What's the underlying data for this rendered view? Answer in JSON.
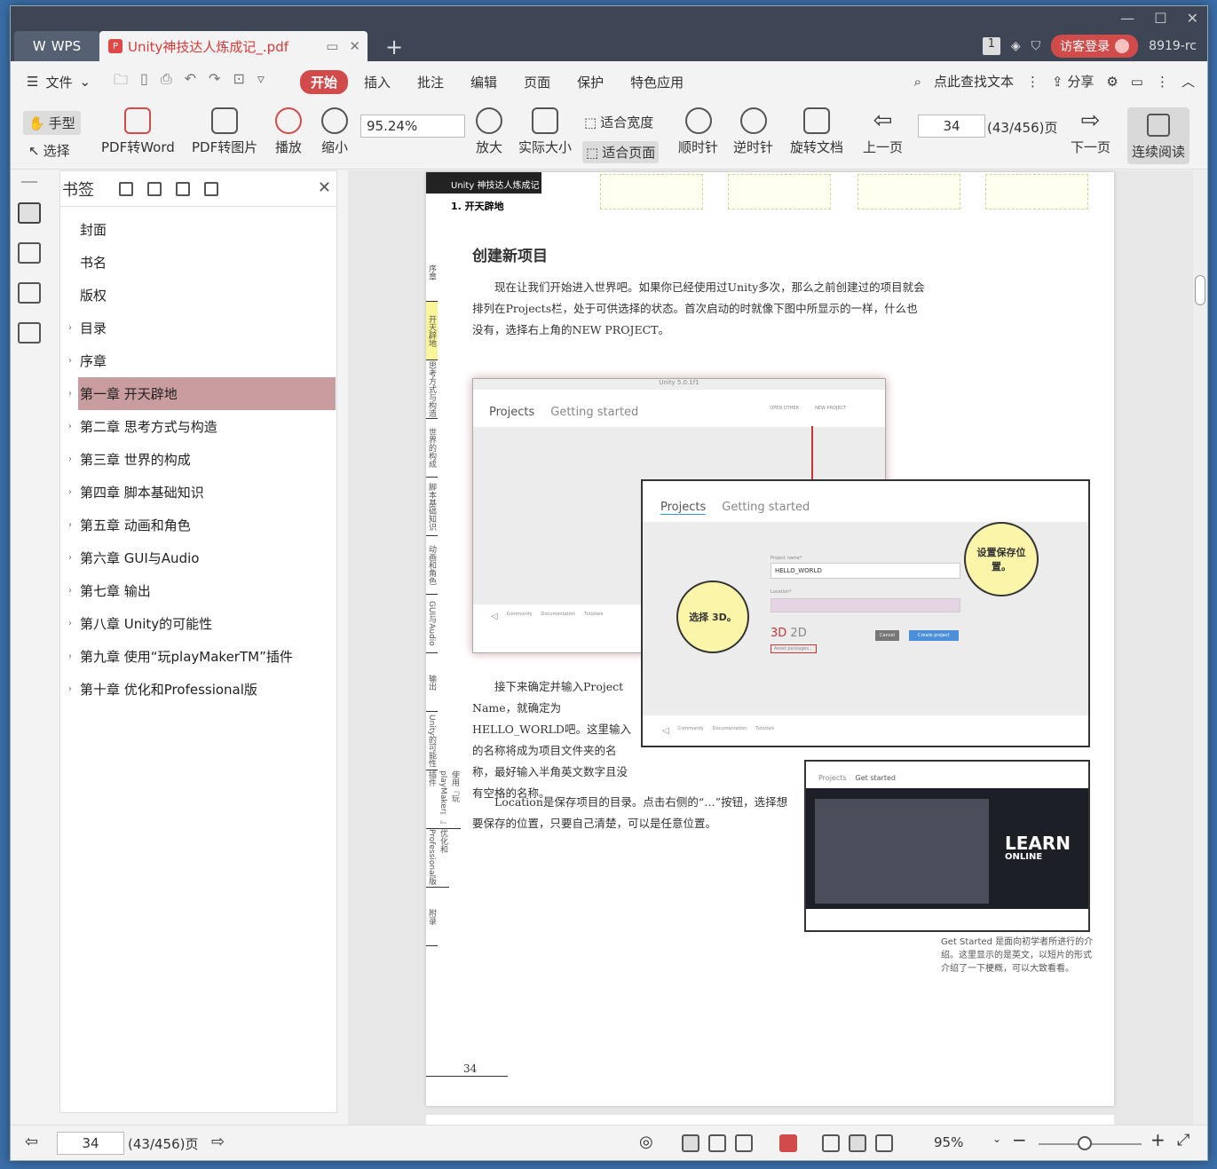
{
  "titlebar": {
    "app_name": "WPS",
    "doc_tab": "Unity神技达人炼成记_.pdf",
    "badge": "1",
    "login": "访客登录",
    "version": "8919-rc"
  },
  "menubar": {
    "file": "文件",
    "items": [
      "开始",
      "插入",
      "批注",
      "编辑",
      "页面",
      "保护",
      "特色应用"
    ],
    "search": "点此查找文本",
    "share": "分享"
  },
  "toolbar": {
    "hand": "手型",
    "select": "选择",
    "pdf_to_word": "PDF转Word",
    "pdf_to_image": "PDF转图片",
    "play": "播放",
    "zoom_out": "缩小",
    "zoom_value": "95.24%",
    "zoom_in": "放大",
    "actual_size": "实际大小",
    "fit_width": "适合宽度",
    "fit_page": "适合页面",
    "clockwise": "顺时针",
    "counterclockwise": "逆时针",
    "rotate_doc": "旋转文档",
    "prev_page": "上一页",
    "page_value": "34",
    "page_total": "(43/456)",
    "page_unit": "页",
    "next_page": "下一页",
    "continuous": "连续阅读"
  },
  "bookmarks": {
    "title": "书签",
    "items": [
      {
        "label": "封面",
        "expandable": false
      },
      {
        "label": "书名",
        "expandable": false
      },
      {
        "label": "版权",
        "expandable": false
      },
      {
        "label": "目录",
        "expandable": true
      },
      {
        "label": "序章",
        "expandable": true
      },
      {
        "label": "第一章  开天辟地",
        "expandable": true,
        "selected": true
      },
      {
        "label": "第二章  思考方式与构造",
        "expandable": true
      },
      {
        "label": "第三章  世界的构成",
        "expandable": true
      },
      {
        "label": "第四章  脚本基础知识",
        "expandable": true
      },
      {
        "label": "第五章  动画和角色",
        "expandable": true
      },
      {
        "label": "第六章  GUI与Audio",
        "expandable": true
      },
      {
        "label": "第七章  输出",
        "expandable": true
      },
      {
        "label": "第八章  Unity的可能性",
        "expandable": true
      },
      {
        "label": "第九章  使用“玩playMakerTM”插件",
        "expandable": true
      },
      {
        "label": "第十章  优化和Professional版",
        "expandable": true
      }
    ]
  },
  "page": {
    "header_black": "Unity 神技达人炼成记",
    "header_sub": "1. 开天辟地",
    "side_index": [
      "序章",
      "开天辟地",
      "思考方式与构造",
      "世界的构成",
      "脚本基础知识",
      "动画和角色",
      "GUI与Audio",
      "输出",
      "Unity的可能性",
      "使用『玩playMaker™』插件",
      "优化和Professional版",
      "附录"
    ],
    "section_title": "创建新项目",
    "para1": "现在让我们开始进入世界吧。如果你已经使用过Unity多次，那么之前创建过的项目就会排列在Projects栏，处于可供选择的状态。首次启动的时就像下图中所显示的一样，什么也没有，选择右上角的NEW PROJECT。",
    "para2": "接下来确定并输入Project Name，就确定为HELLO_WORLD吧。这里输入的名称将成为项目文件夹的名称，最好输入半角英文数字且没有空格的名称。",
    "para3": "Location是保存项目的目录。点击右侧的“…”按钮，选择想要保存的位置，只要自己清楚，可以是任意位置。",
    "shot1_title": "Unity 5.0.1f1",
    "shot_projects": "Projects",
    "shot_getting_started": "Getting started",
    "shot_open_other": "OPEN OTHER",
    "shot_new_project": "NEW PROJECT",
    "shot_footer": [
      "Community",
      "Documentation",
      "Tutorials"
    ],
    "project_name_label": "Project name*",
    "project_name_value": "HELLO_WORLD",
    "location_label": "Location*",
    "mode_3d": "3D",
    "mode_2d": "2D",
    "asset_packages": "Asset packages...",
    "cancel": "Cancel",
    "create": "Create project",
    "bubble1": "选择 3D。",
    "bubble2": "设置保存位置。",
    "shot3_tab1": "Projects",
    "shot3_tab2": "Get started",
    "learn1": "LEARN",
    "learn2": "ONLINE",
    "caption": "Get Started 是面向初学者所进行的介绍。这里显示的是英文，以短片的形式介绍了一下梗概，可以大致看看。",
    "page_number": "34"
  },
  "statusbar": {
    "page_value": "34",
    "page_total": "(43/456)",
    "page_unit": "页",
    "zoom": "95%"
  }
}
